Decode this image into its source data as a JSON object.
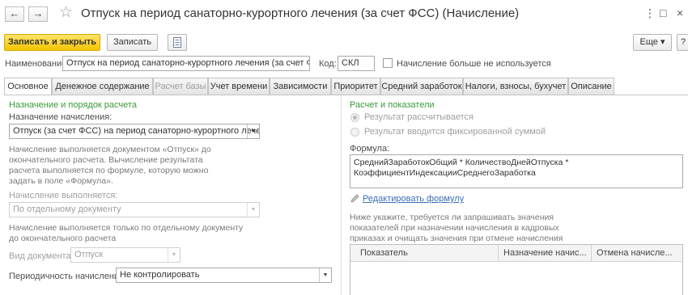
{
  "window": {
    "title": "Отпуск на период санаторно-курортного лечения (за счет ФСС) (Начисление)",
    "back_glyph": "←",
    "forward_glyph": "→",
    "star_glyph": "☆",
    "menu_glyph": "⋮",
    "max_glyph": "□",
    "close_glyph": "×"
  },
  "toolbar": {
    "save_close_label": "Записать и закрыть",
    "save_label": "Записать",
    "more_label": "Еще ▾",
    "help_label": "?"
  },
  "header": {
    "name_label": "Наименование:",
    "name_value": "Отпуск на период санаторно-курортного лечения (за счет ФСС)",
    "code_label": "Код:",
    "code_value": "СКЛ",
    "not_used_label": "Начисление больше не используется"
  },
  "tabs": [
    {
      "label": "Основное"
    },
    {
      "label": "Денежное содержание"
    },
    {
      "label": "Расчет базы"
    },
    {
      "label": "Учет времени"
    },
    {
      "label": "Зависимости"
    },
    {
      "label": "Приоритет"
    },
    {
      "label": "Средний заработок"
    },
    {
      "label": "Налоги, взносы, бухучет"
    },
    {
      "label": "Описание"
    }
  ],
  "left": {
    "section_title": "Назначение и порядок расчета",
    "purpose_label": "Назначение начисления:",
    "purpose_value": "Отпуск (за счет ФСС) на период санаторно-курортного лечения",
    "purpose_hint": "Начисление выполняется документом «Отпуск» до окончательного расчета. Вычисление результата расчета выполняется по формуле, которую можно задать в поле «Формула».",
    "exec_label": "Начисление выполняется:",
    "exec_value": "По отдельному документу",
    "exec_hint": "Начисление выполняется только по отдельному документу до окончательного расчета",
    "doc_type_label": "Вид документа:",
    "doc_type_value": "Отпуск",
    "periodicity_label": "Периодичность начисления:",
    "periodicity_value": "Не контролировать"
  },
  "right": {
    "section_title": "Расчет и показатели",
    "radio_calc_label": "Результат рассчитывается",
    "radio_fixed_label": "Результат вводится фиксированной суммой",
    "formula_label": "Формула:",
    "formula_value": "СреднийЗаработокОбщий * КоличествоДнейОтпуска * КоэффициентИндексацииСреднегоЗаработка",
    "edit_formula_link": "Редактировать формулу",
    "indicators_hint": "Ниже укажите, требуется ли запрашивать значения показателей при назначении начисления в кадровых приказах и очищать значения при отмене начисления",
    "table_headers": [
      "Показатель",
      "Назначение начис...",
      "Отмена начисле..."
    ]
  },
  "colors": {
    "accent_button": "#f4c400",
    "section_title": "#3a9a3a",
    "link": "#3c6fb4"
  }
}
